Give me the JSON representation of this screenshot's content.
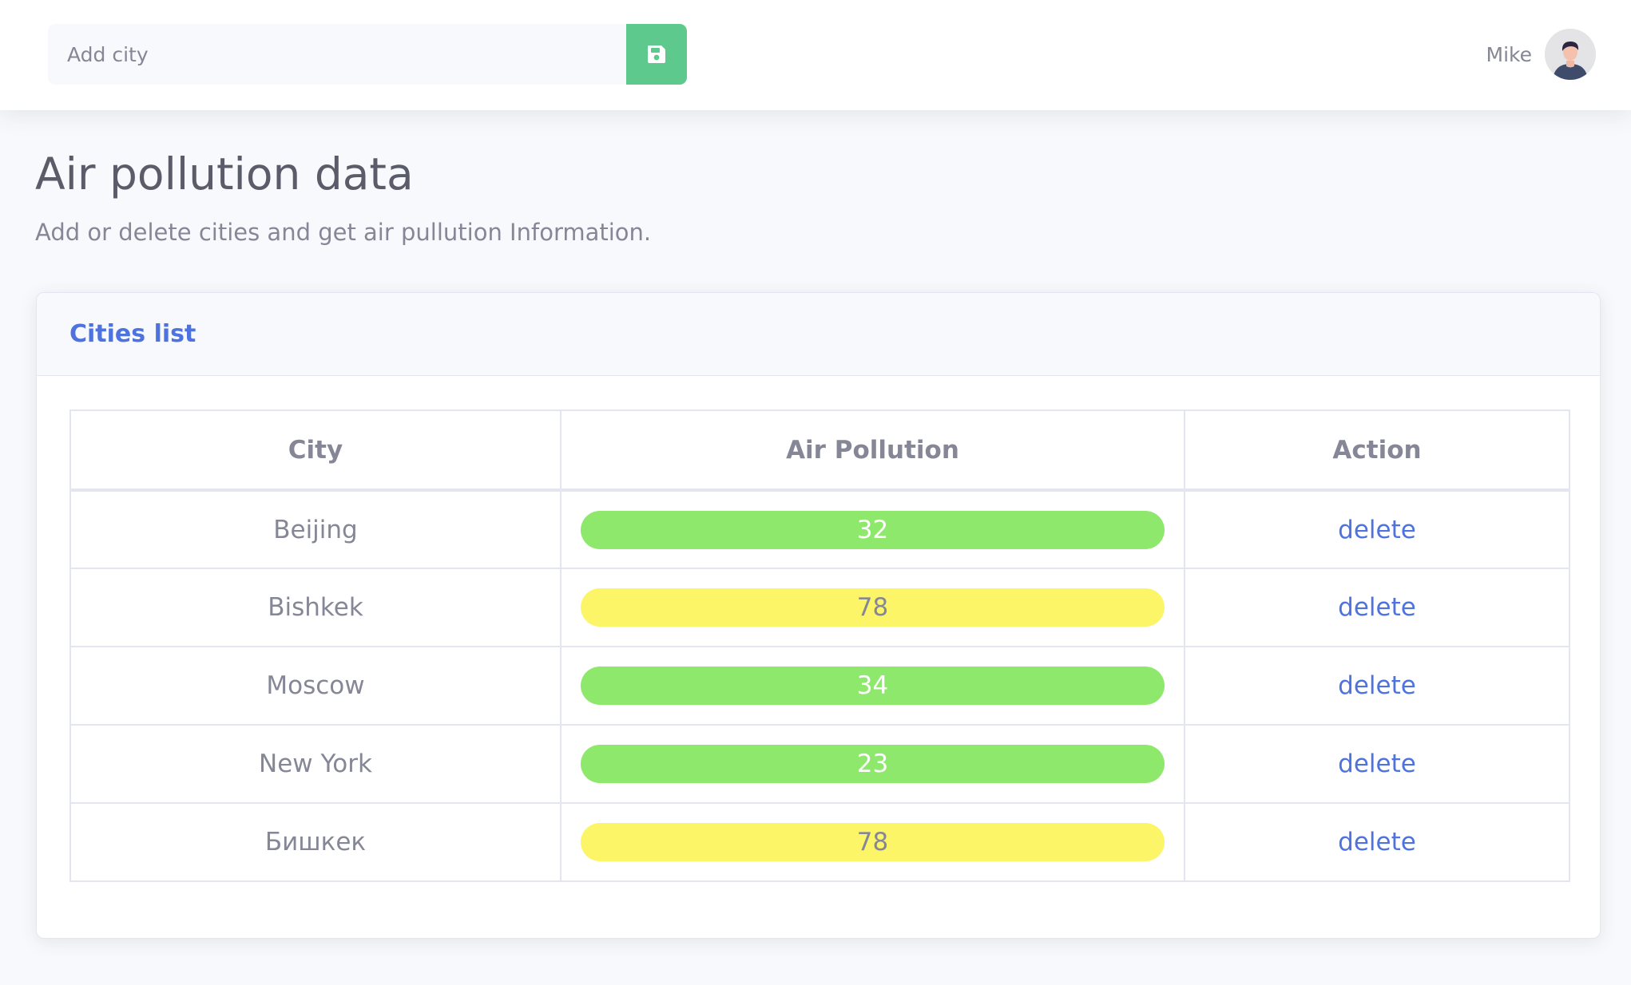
{
  "topbar": {
    "search": {
      "placeholder": "Add city",
      "value": ""
    },
    "save_button": {
      "icon": "save-icon",
      "color": "#5dc98c"
    },
    "user": {
      "name": "Mike",
      "avatar_icon": "user-avatar"
    }
  },
  "page": {
    "title": "Air pollution data",
    "subtitle": "Add or delete cities and get air pullution Information."
  },
  "card": {
    "title": "Cities list",
    "table": {
      "headers": [
        "City",
        "Air Pollution",
        "Action"
      ],
      "rows": [
        {
          "city": "Beijing",
          "pollution": "32",
          "level_color": "#8ee86c",
          "action": "delete"
        },
        {
          "city": "Bishkek",
          "pollution": "78",
          "level_color": "#fcf568",
          "action": "delete"
        },
        {
          "city": "Moscow",
          "pollution": "34",
          "level_color": "#8ee86c",
          "action": "delete"
        },
        {
          "city": "New York",
          "pollution": "23",
          "level_color": "#8ee86c",
          "action": "delete"
        },
        {
          "city": "Бишкек",
          "pollution": "78",
          "level_color": "#fcf568",
          "action": "delete"
        }
      ]
    }
  },
  "colors": {
    "accent": "#4e73df",
    "good": "#8ee86c",
    "moderate": "#fcf568"
  }
}
